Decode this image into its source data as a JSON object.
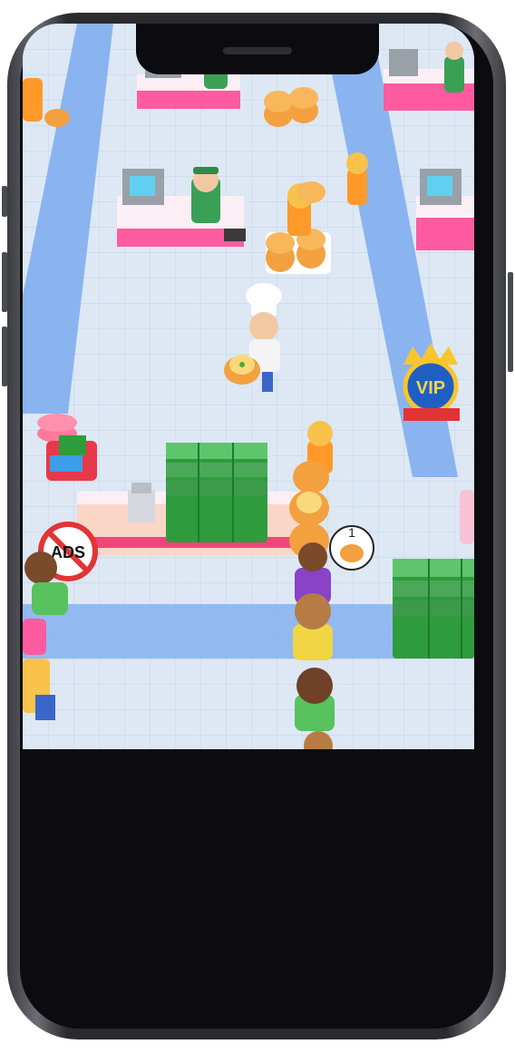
{
  "device": {
    "frame": "phone-frame"
  },
  "game": {
    "ads_label": "ADS",
    "vip_label": "VIP",
    "order_count": "1",
    "colors": {
      "floor": "#dde8f4",
      "walkway": "#8ab4ef",
      "counter_pink": "#f0457a",
      "money_green": "#2e9c3c",
      "vip_blue": "#1f5fc4"
    }
  }
}
